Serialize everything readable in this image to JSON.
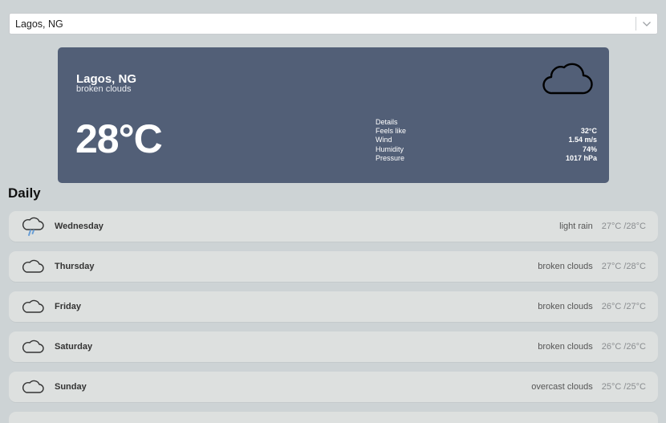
{
  "search": {
    "value": "Lagos, NG"
  },
  "current": {
    "city": "Lagos, NG",
    "description": "broken clouds",
    "temperature": "28°C",
    "details": {
      "title": "Details",
      "rows": [
        {
          "label": "Feels like",
          "value": "32°C"
        },
        {
          "label": "Wind",
          "value": "1.54 m/s"
        },
        {
          "label": "Humidity",
          "value": "74%"
        },
        {
          "label": "Pressure",
          "value": "1017 hPa"
        }
      ]
    }
  },
  "daily": {
    "title": "Daily",
    "days": [
      {
        "name": "Wednesday",
        "description": "light rain",
        "range": "27°C /28°C",
        "icon": "rain-cloud-icon"
      },
      {
        "name": "Thursday",
        "description": "broken clouds",
        "range": "27°C /28°C",
        "icon": "cloud-icon"
      },
      {
        "name": "Friday",
        "description": "broken clouds",
        "range": "26°C /27°C",
        "icon": "cloud-icon"
      },
      {
        "name": "Saturday",
        "description": "broken clouds",
        "range": "26°C /26°C",
        "icon": "cloud-icon"
      },
      {
        "name": "Sunday",
        "description": "overcast clouds",
        "range": "25°C /25°C",
        "icon": "cloud-icon"
      }
    ]
  },
  "colors": {
    "card": "#525f77",
    "background": "#cdd3d5",
    "row": "#dde0df",
    "rain": "#6a9fd6"
  }
}
